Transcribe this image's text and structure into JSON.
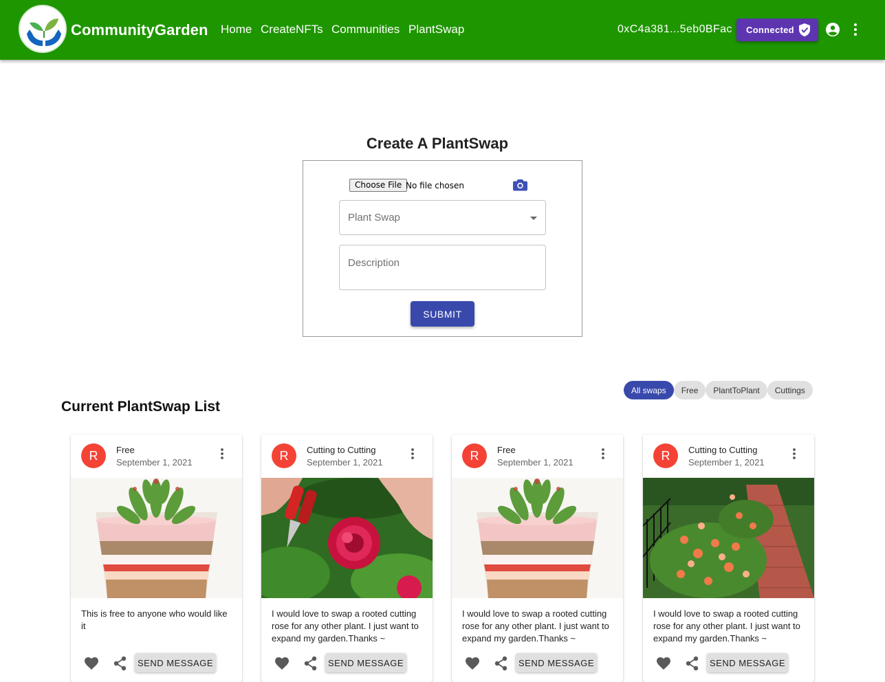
{
  "header": {
    "brand": "CommunityGarden",
    "nav": [
      "Home",
      "CreateNFTs",
      "Communities",
      "PlantSwap"
    ],
    "wallet_address": "0xC4a381...5eb0BFac",
    "connected_label": "Connected",
    "colors": {
      "bar": "#1e9600",
      "connected": "#5e35b1"
    }
  },
  "form": {
    "title": "Create A PlantSwap",
    "file_button": "Choose File",
    "file_status": "No file chosen",
    "select_placeholder": "Plant Swap",
    "description_placeholder": "Description",
    "submit_label": "SUBMIT"
  },
  "list": {
    "title": "Current PlantSwap List",
    "filters": [
      {
        "label": "All swaps",
        "active": true
      },
      {
        "label": "Free",
        "active": false
      },
      {
        "label": "PlantToPlant",
        "active": false
      },
      {
        "label": "Cuttings",
        "active": false
      }
    ],
    "cards": [
      {
        "avatar": "R",
        "title": "Free",
        "date": "September 1, 2021",
        "image": "succulent-in-layered-sand-cup",
        "description": "This is free to anyone who would like it",
        "send_label": "SEND MESSAGE"
      },
      {
        "avatar": "R",
        "title": "Cutting to Cutting",
        "date": "September 1, 2021",
        "image": "pruning-red-rose",
        "description": "I would love to swap a rooted cutting rose for any other plant. I just want to expand my garden.Thanks ~",
        "send_label": "SEND MESSAGE"
      },
      {
        "avatar": "R",
        "title": "Free",
        "date": "September 1, 2021",
        "image": "succulent-in-layered-sand-cup",
        "description": "I would love to swap a rooted cutting rose for any other plant. I just want to expand my garden.Thanks ~",
        "send_label": "SEND MESSAGE"
      },
      {
        "avatar": "R",
        "title": "Cutting to Cutting",
        "date": "September 1, 2021",
        "image": "rose-garden-brick-path",
        "description": "I would love to swap a rooted cutting rose for any other plant. I just want to expand my garden.Thanks ~",
        "send_label": "SEND MESSAGE"
      }
    ]
  }
}
